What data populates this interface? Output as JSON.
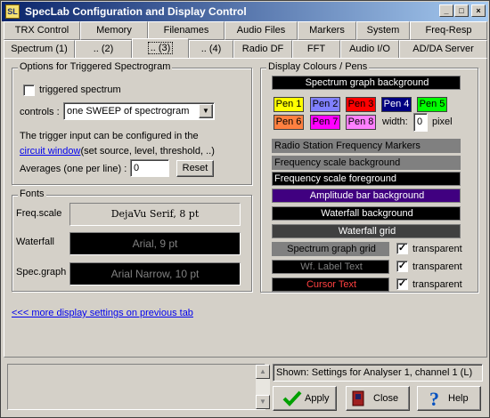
{
  "window": {
    "title": "SpecLab  Configuration and Display Control",
    "app_icon_text": "SL",
    "min": "_",
    "max": "□",
    "close": "×"
  },
  "tabs_row1": [
    "TRX Control",
    "Memory",
    "Filenames",
    "Audio Files",
    "Markers",
    "System",
    "Freq-Resp"
  ],
  "tabs_row2": [
    "Spectrum (1)",
    ".. (2)",
    ".. (3)",
    ".. (4)",
    "Radio DF",
    "FFT",
    "Audio I/O",
    "AD/DA Server"
  ],
  "active_tab": ".. (3)",
  "trigger": {
    "legend": "Options for Triggered Spectrogram",
    "checkbox_label": "triggered spectrum",
    "checked": false,
    "controls_label": "controls :",
    "controls_value": "one SWEEP of spectrogram",
    "info_line1": "The trigger input can be configured in the",
    "info_link": "circuit window",
    "info_line2": "(set source, level, threshold, ..)",
    "averages_label": "Averages (one per line) :",
    "averages_value": "0",
    "reset_label": "Reset"
  },
  "fonts": {
    "legend": "Fonts",
    "rows": [
      {
        "label": "Freq.scale",
        "value": "DejaVu Serif, 8 pt"
      },
      {
        "label": "Waterfall",
        "value": "Arial, 9 pt"
      },
      {
        "label": "Spec.graph",
        "value": "Arial Narrow, 10 pt"
      }
    ]
  },
  "colours": {
    "legend": "Display Colours / Pens",
    "spectrum_bg": "Spectrum graph background",
    "pens": [
      "Pen 1",
      "Pen 2",
      "Pen 3",
      "Pen 4",
      "Pen 5",
      "Pen 6",
      "Pen 7",
      "Pen 8"
    ],
    "pen_colors": [
      "#ffff00",
      "#8080ff",
      "#ff0000",
      "#000080",
      "#00ff00",
      "#ff8040",
      "#ff00ff",
      "#ff80ff"
    ],
    "width_label": "width:",
    "width_value": "0",
    "pixel_label": "pixel",
    "radio_markers": "Radio Station Frequency Markers",
    "freq_bg": "Frequency scale background",
    "freq_fg": "Frequency scale foreground",
    "amp_bg": "Amplitude bar background",
    "wf_bg": "Waterfall background",
    "wf_grid": "Waterfall grid",
    "spec_grid": "Spectrum graph grid",
    "wf_label": "Wf. Label Text",
    "cursor": "Cursor Text",
    "transparent": "transparent"
  },
  "more_link": "<<< more display settings on previous tab",
  "footer": {
    "shown": "Shown: Settings for Analyser 1, channel 1 (L)",
    "apply": "Apply",
    "close": "Close",
    "help": "Help"
  }
}
